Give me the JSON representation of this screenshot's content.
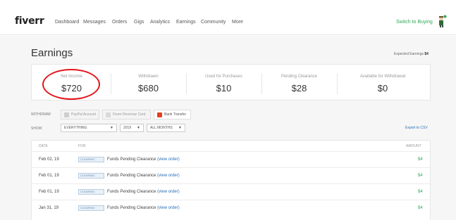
{
  "header": {
    "logo": "fiverr",
    "nav": [
      "Dashboard",
      "Messages",
      "Orders",
      "Gigs",
      "Analytics",
      "Earnings",
      "Community",
      "More"
    ],
    "switch_label": "Switch to Buying",
    "online_color": "#2eaa56"
  },
  "page": {
    "title": "Earnings",
    "expected_label": "Expected Earnings",
    "expected_value": "$4"
  },
  "stats": [
    {
      "label": "Net Income",
      "value": "$720"
    },
    {
      "label": "Withdrawn",
      "value": "$680"
    },
    {
      "label": "Used for Purchases",
      "value": "$10"
    },
    {
      "label": "Pending Clearance",
      "value": "$28"
    },
    {
      "label": "Available for Withdrawal",
      "value": "$0"
    }
  ],
  "withdraw": {
    "label": "WITHDRAW",
    "options": [
      "PayPal Account",
      "Fiverr Revenue Card",
      "Bank Transfer"
    ]
  },
  "filters": {
    "label": "SHOW",
    "type_value": "EVERYTHING",
    "year_value": "2019",
    "month_value": "ALL MONTHS",
    "export_label": "Export to CSV"
  },
  "table": {
    "headers": {
      "date": "DATE",
      "for": "FOR",
      "amount": "AMOUNT"
    },
    "rows": [
      {
        "date": "Feb 02, 19",
        "badge": "CLEARING",
        "desc": "Funds Pending Clearance",
        "link": "(view order)",
        "amount": "$4"
      },
      {
        "date": "Feb 01, 19",
        "badge": "CLEARING",
        "desc": "Funds Pending Clearance",
        "link": "(view order)",
        "amount": "$4"
      },
      {
        "date": "Feb 01, 19",
        "badge": "CLEARING",
        "desc": "Funds Pending Clearance",
        "link": "(view order)",
        "amount": "$4"
      },
      {
        "date": "Jan 31, 19",
        "badge": "CLEARING",
        "desc": "Funds Pending Clearance",
        "link": "(view order)",
        "amount": "$4"
      }
    ]
  },
  "colors": {
    "accent_green": "#2eaa56",
    "link_blue": "#2a6fb8",
    "annotation_red": "#e3161b"
  }
}
